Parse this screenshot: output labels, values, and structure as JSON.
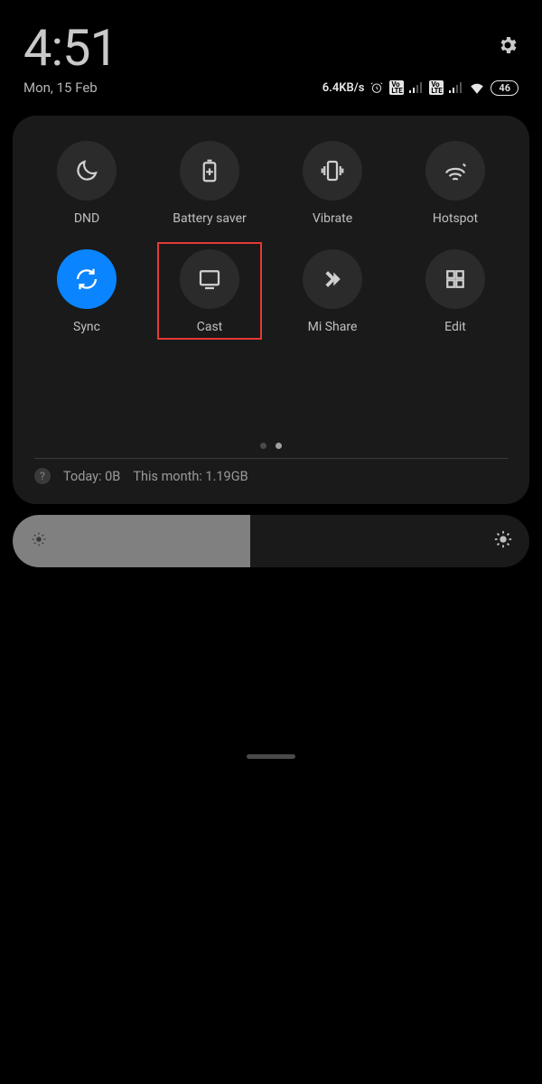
{
  "status": {
    "time": "4:51",
    "date": "Mon, 15 Feb",
    "net_speed": "6.4KB/s",
    "battery_level": "46"
  },
  "tiles": [
    {
      "label": "DND",
      "icon": "moon",
      "active": false
    },
    {
      "label": "Battery saver",
      "icon": "battery-plus",
      "active": false
    },
    {
      "label": "Vibrate",
      "icon": "vibrate",
      "active": false
    },
    {
      "label": "Hotspot",
      "icon": "hotspot",
      "active": false
    },
    {
      "label": "Sync",
      "icon": "sync",
      "active": true
    },
    {
      "label": "Cast",
      "icon": "cast",
      "active": false,
      "highlight": true
    },
    {
      "label": "Mi Share",
      "icon": "mishare",
      "active": false
    },
    {
      "label": "Edit",
      "icon": "grid4",
      "active": false
    }
  ],
  "data_usage": {
    "today_label": "Today: 0B",
    "month_label": "This month: 1.19GB"
  },
  "brightness": {
    "percent": 46
  }
}
